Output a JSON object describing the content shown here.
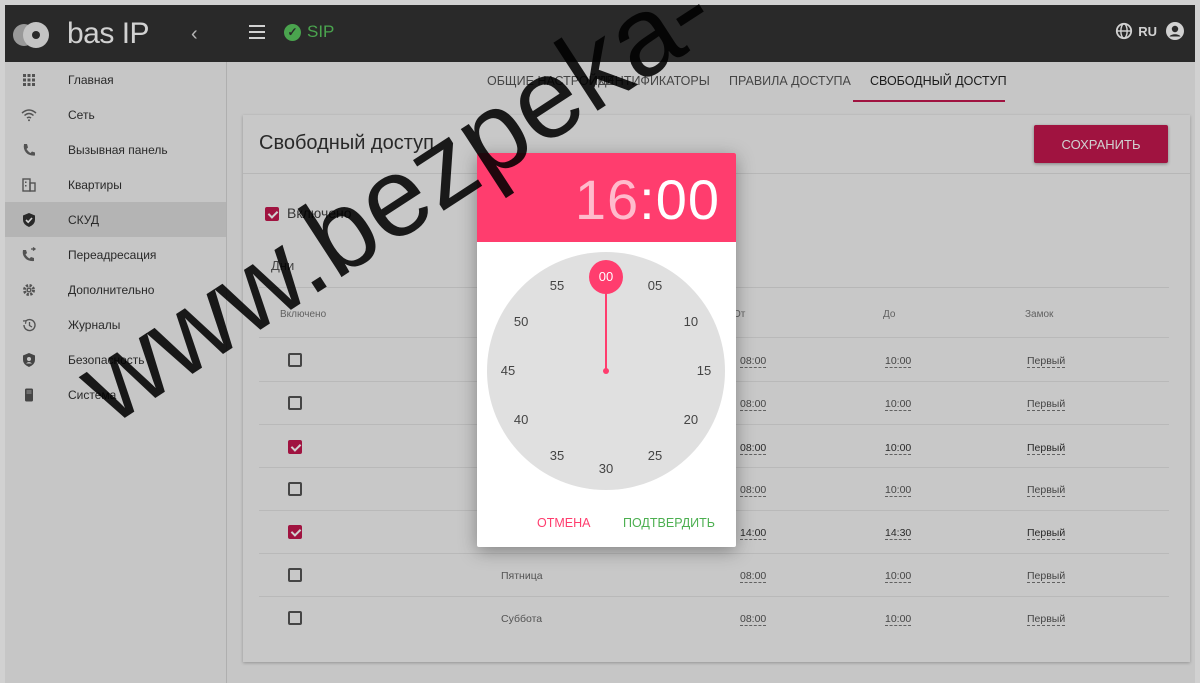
{
  "app": {
    "logo_text": "bas IP",
    "sip_label": "SIP",
    "lang": "RU"
  },
  "sidebar": {
    "items": [
      {
        "label": "Главная",
        "icon": "grid-icon"
      },
      {
        "label": "Сеть",
        "icon": "wifi-icon"
      },
      {
        "label": "Вызывная панель",
        "icon": "phone-icon"
      },
      {
        "label": "Квартиры",
        "icon": "building-icon"
      },
      {
        "label": "СКУД",
        "icon": "shield-check-icon"
      },
      {
        "label": "Переадресация",
        "icon": "phone-forward-icon"
      },
      {
        "label": "Дополнительно",
        "icon": "gear-icon"
      },
      {
        "label": "Журналы",
        "icon": "history-icon"
      },
      {
        "label": "Безопасность",
        "icon": "shield-icon"
      },
      {
        "label": "Система",
        "icon": "device-icon"
      }
    ],
    "active_index": 4
  },
  "tabs": [
    {
      "label": "ОБЩИЕ НАСТРОЙКИ"
    },
    {
      "label": "ИДЕНТИФИКАТОРЫ"
    },
    {
      "label": "ПРАВИЛА ДОСТУПА"
    },
    {
      "label": "СВОБОДНЫЙ ДОСТУП",
      "active": true
    }
  ],
  "card": {
    "title": "Свободный доступ",
    "save_label": "СОХРАНИТЬ",
    "enabled_label": "Включено",
    "enabled_checked": true,
    "days_label": "Дни",
    "columns": {
      "enabled": "Включено",
      "from": "От",
      "to": "До",
      "lock": "Замок"
    },
    "rows": [
      {
        "checked": false,
        "day": "",
        "from": "08:00",
        "to": "10:00",
        "lock": "Первый"
      },
      {
        "checked": false,
        "day": "",
        "from": "08:00",
        "to": "10:00",
        "lock": "Первый"
      },
      {
        "checked": true,
        "day": "",
        "from": "08:00",
        "to": "10:00",
        "lock": "Первый"
      },
      {
        "checked": false,
        "day": "",
        "from": "08:00",
        "to": "10:00",
        "lock": "Первый"
      },
      {
        "checked": true,
        "day": "",
        "from": "14:00",
        "to": "14:30",
        "lock": "Первый"
      },
      {
        "checked": false,
        "day": "Пятница",
        "from": "08:00",
        "to": "10:00",
        "lock": "Первый"
      },
      {
        "checked": false,
        "day": "Суббота",
        "from": "08:00",
        "to": "10:00",
        "lock": "Первый"
      }
    ]
  },
  "dialog": {
    "hours": "16",
    "separator": ":",
    "minutes": "00",
    "selected": "00",
    "dial": [
      "00",
      "05",
      "10",
      "15",
      "20",
      "25",
      "30",
      "35",
      "40",
      "45",
      "50",
      "55"
    ],
    "cancel_label": "ОТМЕНА",
    "confirm_label": "ПОДТВЕРДИТЬ"
  },
  "watermark": "www.bezpeka-",
  "colors": {
    "accent": "#c4184f",
    "picker_accent": "#ff3d6e",
    "sip_green": "#5bc860",
    "confirm_green": "#4caf50"
  }
}
